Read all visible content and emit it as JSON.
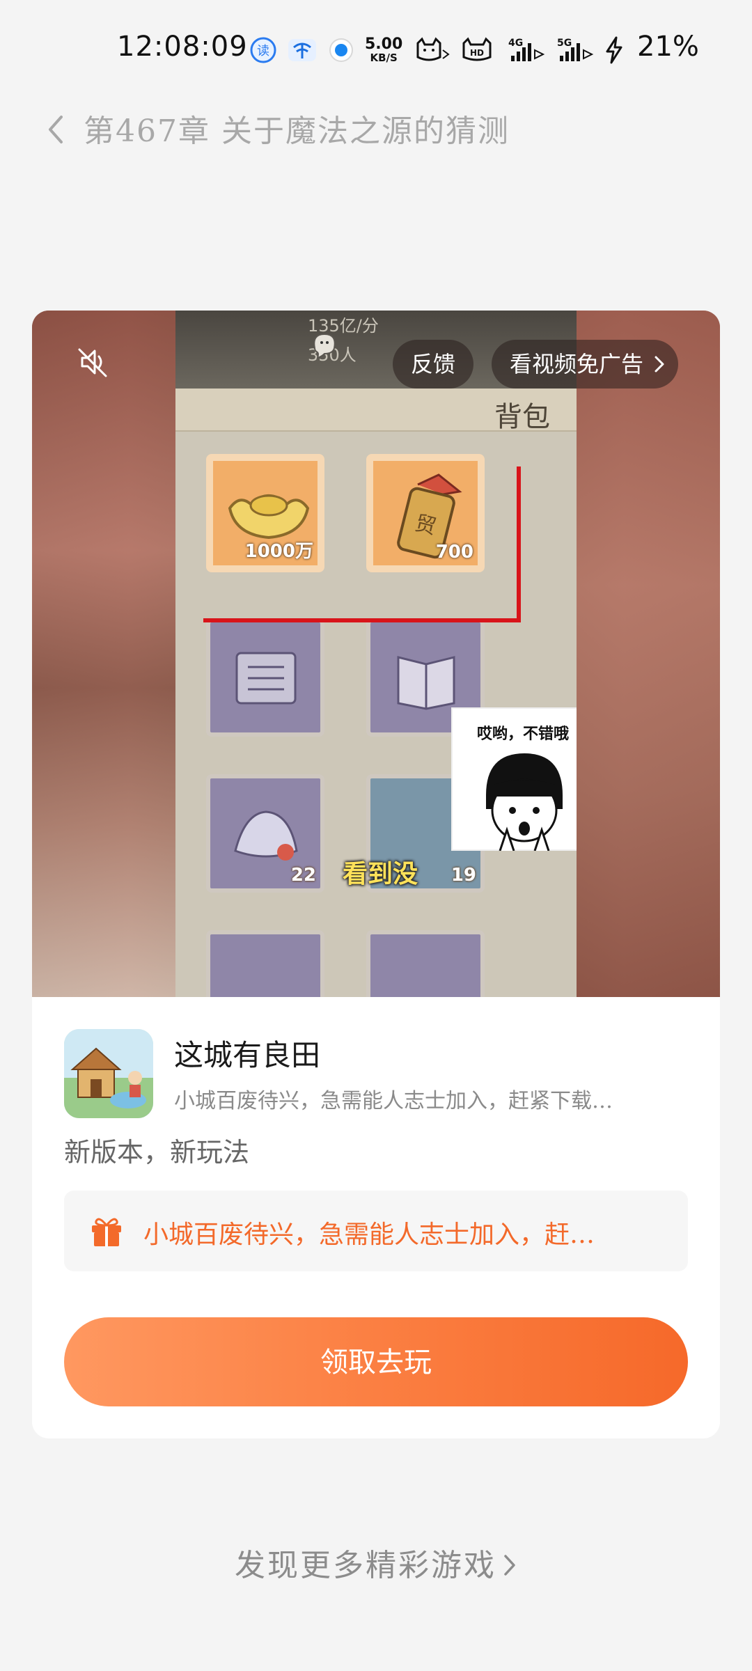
{
  "status_bar": {
    "time": "12:08:09",
    "net_speed_value": "5.00",
    "net_speed_unit": "KB/S",
    "signal_4g": "4G",
    "signal_5g": "5G",
    "battery": "21%"
  },
  "header": {
    "chapter_title": "第467章 关于魔法之源的猜测"
  },
  "ad": {
    "feedback_label": "反馈",
    "skip_ad_label": "看视频免广告",
    "video": {
      "stat_top": "135亿/分",
      "stat_second": "350人",
      "bag_label": "背包",
      "gold_count": "1000万",
      "tag_count": "700",
      "slot_count_a": "22",
      "slot_count_b": "19",
      "meme_text": "哎哟，不错哦",
      "subtitle": "看到没"
    },
    "app_name": "这城有良田",
    "app_description": "小城百废待兴，急需能人志士加入，赶紧下载…",
    "slogan": "新版本，新玩法",
    "promo_text": "小城百废待兴，急需能人志士加入，赶…",
    "cta_label": "领取去玩"
  },
  "footer": {
    "discover_label": "发现更多精彩游戏"
  },
  "colors": {
    "accent_orange": "#f6692a",
    "highlight_red": "#d8141a"
  }
}
